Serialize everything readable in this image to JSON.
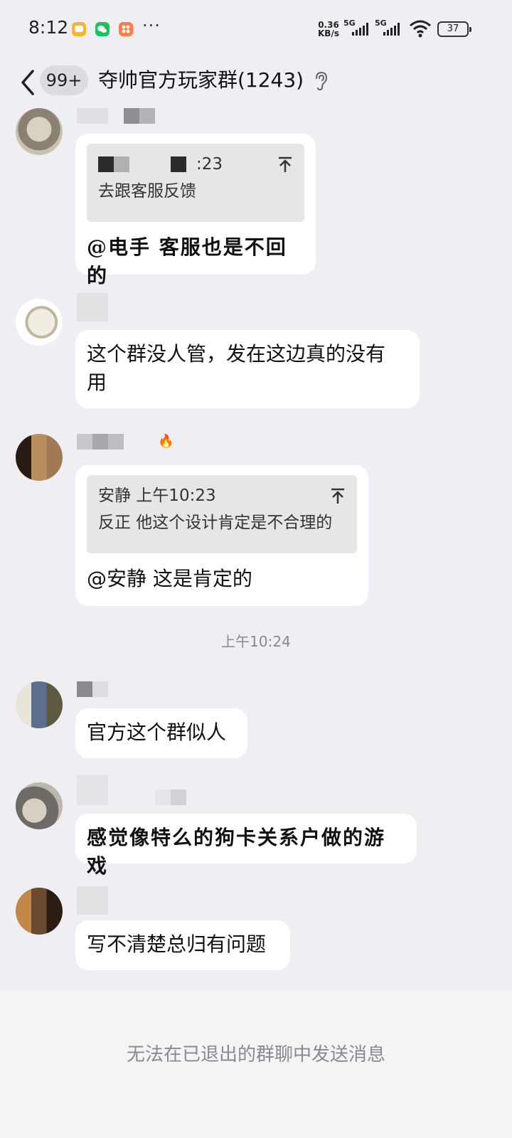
{
  "status_bar": {
    "time": "8:12",
    "more": "···",
    "net_speed_value": "0.36",
    "net_speed_unit": "KB/s",
    "sim1": "5G",
    "sim2": "5G",
    "battery": "37",
    "app_icons": [
      "messages-app-icon",
      "wechat-app-icon",
      "app-store-icon"
    ]
  },
  "nav": {
    "unread_badge": "99+",
    "title": "夺帅官方玩家群(1243)",
    "icons": [
      "back-icon",
      "ear-icon"
    ]
  },
  "messages": [
    {
      "quote_time": ":23",
      "quote_text": "去跟客服反馈",
      "text": "@电手 客服也是不回的"
    },
    {
      "text_line1": "这个群没人管，发在这边真的没有",
      "text_line2": "用"
    },
    {
      "nick_badge": "🔥",
      "quote_author_time": "安静 上午10:23",
      "quote_text": "反正 他这个设计肯定是不合理的",
      "text": "@安静 这是肯定的"
    },
    {
      "text": "官方这个群似人"
    },
    {
      "text": "感觉像特么的狗卡关系户做的游戏"
    },
    {
      "text": "写不清楚总归有问题"
    }
  ],
  "timestamp": "上午10:24",
  "bottom_notice": "无法在已退出的群聊中发送消息",
  "colors": {
    "background": "#efeff3",
    "bubble": "#ffffff",
    "quote": "#e6e6e9",
    "muted_text": "#8a8a8e"
  }
}
